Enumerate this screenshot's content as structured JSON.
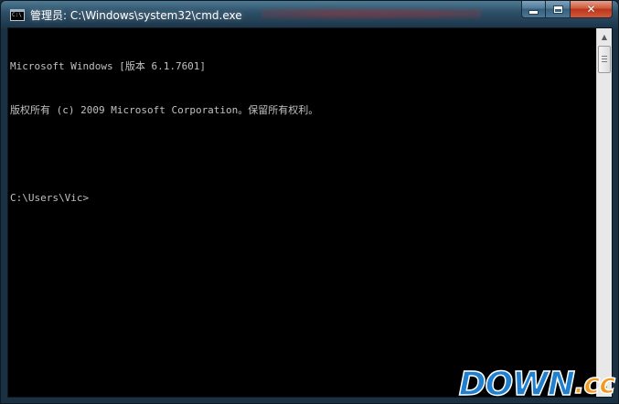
{
  "window": {
    "title": "管理员: C:\\Windows\\system32\\cmd.exe",
    "icon_label": "C:\\",
    "icon_name": "cmd-icon",
    "buttons": {
      "minimize": "minimize-icon",
      "maximize": "maximize-icon",
      "close": "close-icon",
      "close_glyph": "✕"
    }
  },
  "console": {
    "lines": [
      "Microsoft Windows [版本 6.1.7601]",
      "版权所有 (c) 2009 Microsoft Corporation。保留所有权利。",
      "",
      "C:\\Users\\Vic>"
    ],
    "foreground": "#c0c0c0",
    "background": "#000000"
  },
  "scrollbar": {
    "up_arrow": "▲",
    "down_arrow": "▼"
  },
  "watermark": {
    "main": "DOWN",
    "tld": ".cc",
    "colors": {
      "main": "#1f7fd0",
      "tld": "#f29a1f"
    }
  }
}
